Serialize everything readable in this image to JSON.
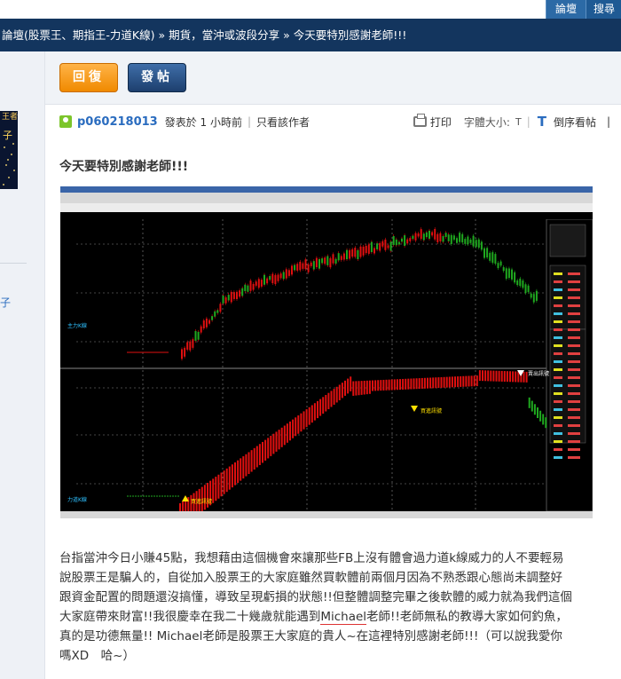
{
  "topnav": {
    "items": [
      "論壇",
      "搜尋"
    ]
  },
  "breadcrumb": {
    "items": [
      "論壇(股票王、期指王-力道K線)",
      "期貨，當沖或波段分享",
      "今天要特別感謝老師!!!"
    ],
    "separator": "»"
  },
  "sidebar": {
    "avatar_label_top": "王者",
    "avatar_label_bottom": "子",
    "link_text": "子"
  },
  "actions": {
    "reply_label": "回復",
    "post_label": "發帖"
  },
  "post": {
    "author": "p060218013",
    "posted": "發表於 1 小時前",
    "author_only": "只看該作者",
    "print_label": "打印",
    "font_size_label": "字體大小:",
    "font_small": "T",
    "font_large": "T",
    "order_label": "倒序看帖",
    "title": "今天要特別感謝老師!!!",
    "body_lines": [
      "台指當沖今日小賺45點，我想藉由這個機會來讓那些FB上沒有體會過力道k線威力的人不要輕易",
      "說股票王是騙人的，自從加入股票王的大家庭雖然買軟體前兩個月因為不熟悉跟心態尚未調整好",
      "跟資金配置的問題還沒搞懂，導致呈現虧損的狀態!!但整體調整完畢之後軟體的威力就為我們這個",
      "大家庭帶來財富!!我很慶幸在我二十幾歲就能遇到",
      "老師!!老師無私的教導大家如何釣魚，",
      "真的是功德無量!! Michael老師是股票王大家庭的貴人~在這裡特別感謝老師!!!（可以說我愛你",
      "嗎XD　哈~）"
    ],
    "mention": "Michael"
  },
  "chart_image": {
    "upper_panel_label": "主力K線",
    "lower_panel_label": "力道K線",
    "buy_signal_label": "買進訊號",
    "sell_signal_label": "賣出訊號",
    "bullish": "#e01010",
    "bearish": "#1fa81f"
  }
}
